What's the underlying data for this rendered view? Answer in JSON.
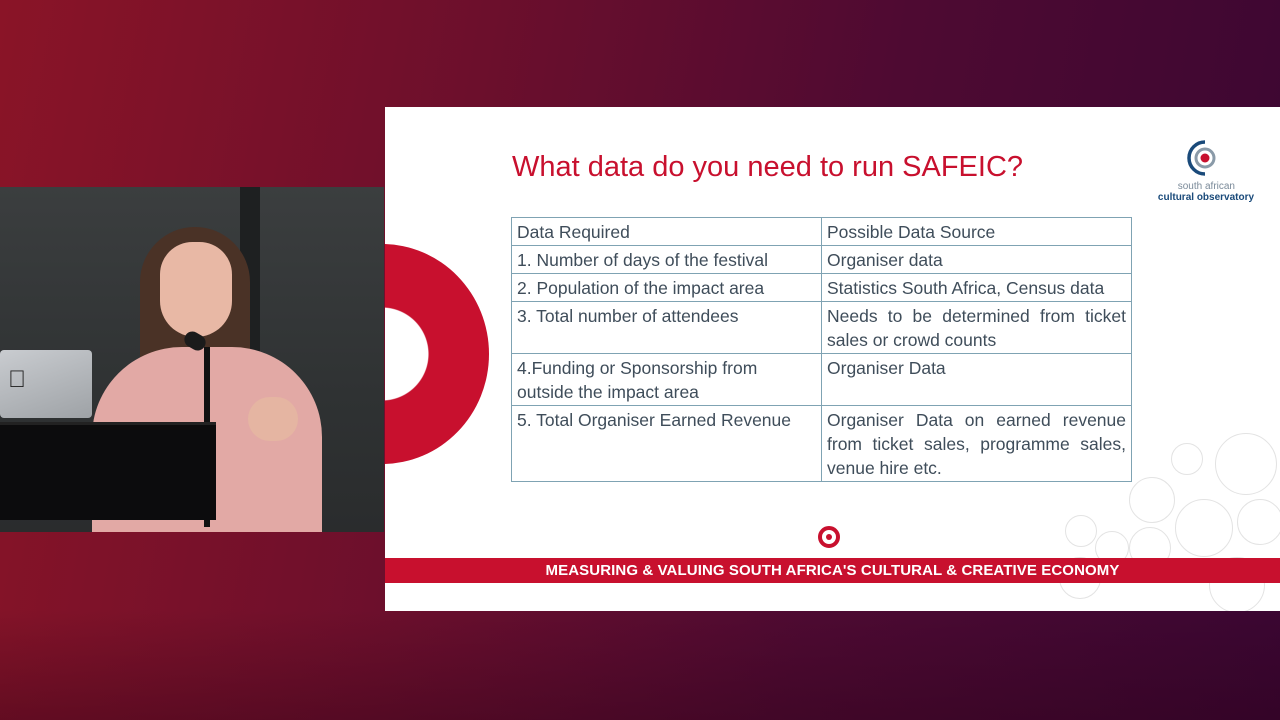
{
  "slide": {
    "title": "What data do you need to run SAFEIC?",
    "logo": {
      "line1": "south african",
      "line2": "cultural observatory"
    },
    "table": {
      "headers": [
        "Data Required",
        "Possible Data Source"
      ],
      "rows": [
        [
          "1. Number of days of the festival",
          "Organiser data"
        ],
        [
          "2. Population of the impact area",
          "Statistics South Africa, Census data"
        ],
        [
          "3. Total number of attendees",
          "Needs to be determined from ticket sales or crowd counts"
        ],
        [
          "4.Funding or Sponsorship from outside the impact area",
          "Organiser Data"
        ],
        [
          "5. Total Organiser Earned Revenue",
          "Organiser Data on earned revenue from ticket sales, programme sales, venue hire etc."
        ]
      ]
    },
    "banner": "MEASURING & VALUING SOUTH AFRICA'S CULTURAL & CREATIVE ECONOMY",
    "colors": {
      "accent": "#c8102e",
      "table_border": "#7fa3b3",
      "text": "#3f4d5a"
    }
  },
  "video": {
    "icons": [
      "apple-icon"
    ]
  }
}
